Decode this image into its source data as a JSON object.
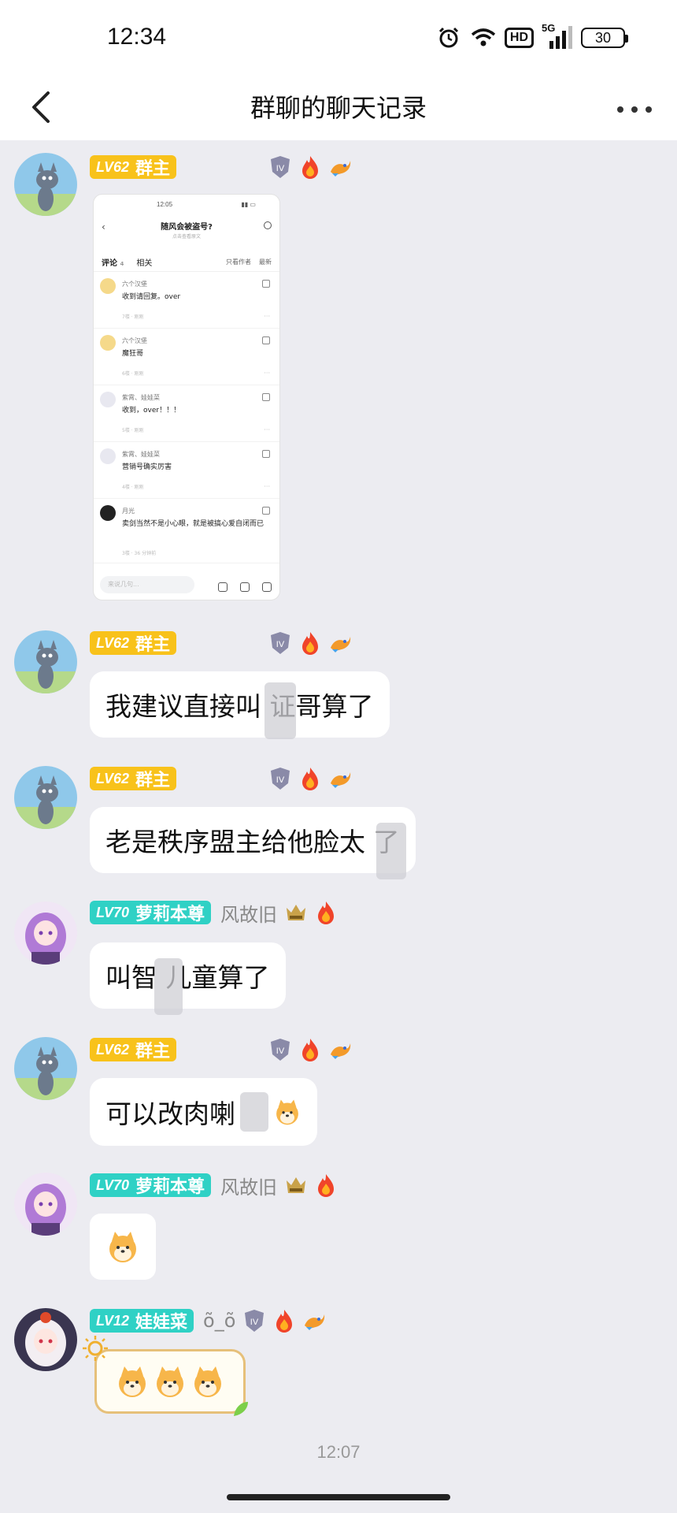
{
  "status_bar": {
    "time": "12:34",
    "network": "5G",
    "hd": "HD",
    "battery": "30"
  },
  "nav": {
    "title": "群聊的聊天记录"
  },
  "colors": {
    "level_gold": "#f8c21b",
    "level_teal": "#2fd1c5",
    "background": "#ececf1",
    "bubble": "#ffffff"
  },
  "messages": [
    {
      "level": "LV62",
      "title": "群主",
      "type": "image",
      "screenshot": {
        "status_time": "12:05",
        "post_title": "随风会被盗号?",
        "post_sub": "点击查看原文",
        "tab_comments": "评论",
        "comment_count": "4",
        "tab_related": "相关",
        "filter_author": "只看作者",
        "sort": "最新",
        "comments": [
          {
            "name": "六个汉堡",
            "text": "收到请回复。over",
            "meta": "7楼 · 刚刚"
          },
          {
            "name": "六个汉堡",
            "text": "魔狂哥",
            "meta": "6楼 · 刚刚"
          },
          {
            "name": "紫霄、娃娃菜",
            "text": "收到，over！！！",
            "meta": "5楼 · 刚刚"
          },
          {
            "name": "紫霄、娃娃菜",
            "text": "营销号确实厉害",
            "meta": "4楼 · 刚刚"
          },
          {
            "name": "月光",
            "text": "卖剑当然不是小心眼，就是被搞心爱自闭而已",
            "meta": "3楼 · 36 分钟前"
          }
        ],
        "input_placeholder": "来说几句..."
      }
    },
    {
      "level": "LV62",
      "title": "群主",
      "type": "text",
      "text": "我建议直接叫 证哥算了"
    },
    {
      "level": "LV62",
      "title": "群主",
      "type": "text",
      "text": "老是秩序盟主给他脸太 了"
    },
    {
      "level": "LV70",
      "title": "萝莉本尊",
      "nickname": "风故旧",
      "type": "text",
      "text": "叫智 儿童算了"
    },
    {
      "level": "LV62",
      "title": "群主",
      "type": "text",
      "text": "可以改肉喇"
    },
    {
      "level": "LV70",
      "title": "萝莉本尊",
      "nickname": "风故旧",
      "type": "sticker",
      "sticker": "shiba-sticker"
    },
    {
      "level": "LV12",
      "title": "娃娃菜",
      "nickname": "õ_õ",
      "type": "sticker-row",
      "sticker": "shiba-sticker"
    }
  ],
  "timestamp": "12:07"
}
